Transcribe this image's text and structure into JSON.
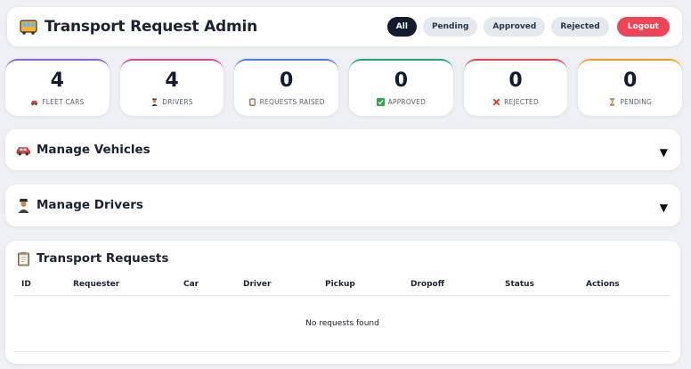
{
  "header": {
    "title": "Transport Request Admin",
    "icon": "bus-icon",
    "filters": [
      "All",
      "Pending",
      "Approved",
      "Rejected"
    ],
    "active_filter": "All",
    "logout_label": "Logout"
  },
  "stats": [
    {
      "value": "4",
      "label": "FLEET CARS",
      "icon": "car-icon",
      "accent": "#8a63d2"
    },
    {
      "value": "4",
      "label": "DRIVERS",
      "icon": "driver-icon",
      "accent": "#d9488b"
    },
    {
      "value": "0",
      "label": "REQUESTS RAISED",
      "icon": "clipboard-icon",
      "accent": "#4a7fe0"
    },
    {
      "value": "0",
      "label": "APPROVED",
      "icon": "check-icon",
      "accent": "#1fa971"
    },
    {
      "value": "0",
      "label": "REJECTED",
      "icon": "cross-icon",
      "accent": "#e0474c"
    },
    {
      "value": "0",
      "label": "PENDING",
      "icon": "hourglass-icon",
      "accent": "#e9a21a"
    }
  ],
  "vehicles": {
    "title": "Manage Vehicles",
    "icon": "car-icon",
    "toggle": "▼"
  },
  "drivers": {
    "title": "Manage Drivers",
    "icon": "driver-icon",
    "toggle": "▼"
  },
  "requests": {
    "title": "Transport Requests",
    "icon": "clipboard-icon",
    "columns": [
      "ID",
      "Requester",
      "Car",
      "Driver",
      "Pickup",
      "Dropoff",
      "Status",
      "Actions"
    ],
    "empty_text": "No requests found"
  }
}
